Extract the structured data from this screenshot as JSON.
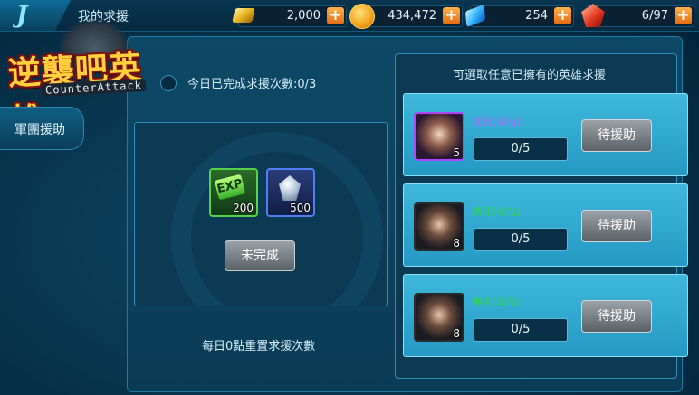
{
  "header": {
    "back_glyph": "J",
    "title": "我的求援",
    "resources": [
      {
        "icon": "gold-bar-icon",
        "value": "2,000"
      },
      {
        "icon": "coin-icon",
        "value": "434,472"
      },
      {
        "icon": "crystal-icon",
        "value": "254"
      },
      {
        "icon": "ruby-icon",
        "value": "6/97"
      }
    ],
    "plus_label": "+"
  },
  "logo": {
    "title": "逆襲吧英雄",
    "subtitle": "CounterAttack"
  },
  "sidebar": {
    "items": [
      {
        "label": "軍團援助"
      }
    ]
  },
  "request": {
    "count_text": "今日已完成求援次數:0/3",
    "rewards": [
      {
        "icon": "exp-icon",
        "badge": "EXP",
        "amount": "200"
      },
      {
        "icon": "shard-icon",
        "amount": "500"
      }
    ],
    "status_button": "未完成",
    "reset_note": "每日0點重置求援次數"
  },
  "heroes": {
    "title": "可選取任意已擁有的英雄求援",
    "list": [
      {
        "name": "龐統(魂石)",
        "level": "5",
        "progress": "0/5",
        "progress_value": 0,
        "rarity_color": "#a86bff",
        "button": "待援助"
      },
      {
        "name": "賈詡(魂石)",
        "level": "8",
        "progress": "0/5",
        "progress_value": 0,
        "rarity_color": "#2fd35a",
        "button": "待援助"
      },
      {
        "name": "無名(魂石)",
        "level": "8",
        "progress": "0/5",
        "progress_value": 0,
        "rarity_color": "#2fd35a",
        "button": "待援助"
      }
    ]
  },
  "colors": {
    "accent": "#2d8fba",
    "card": "#2499c4",
    "plus": "#e46a10"
  }
}
